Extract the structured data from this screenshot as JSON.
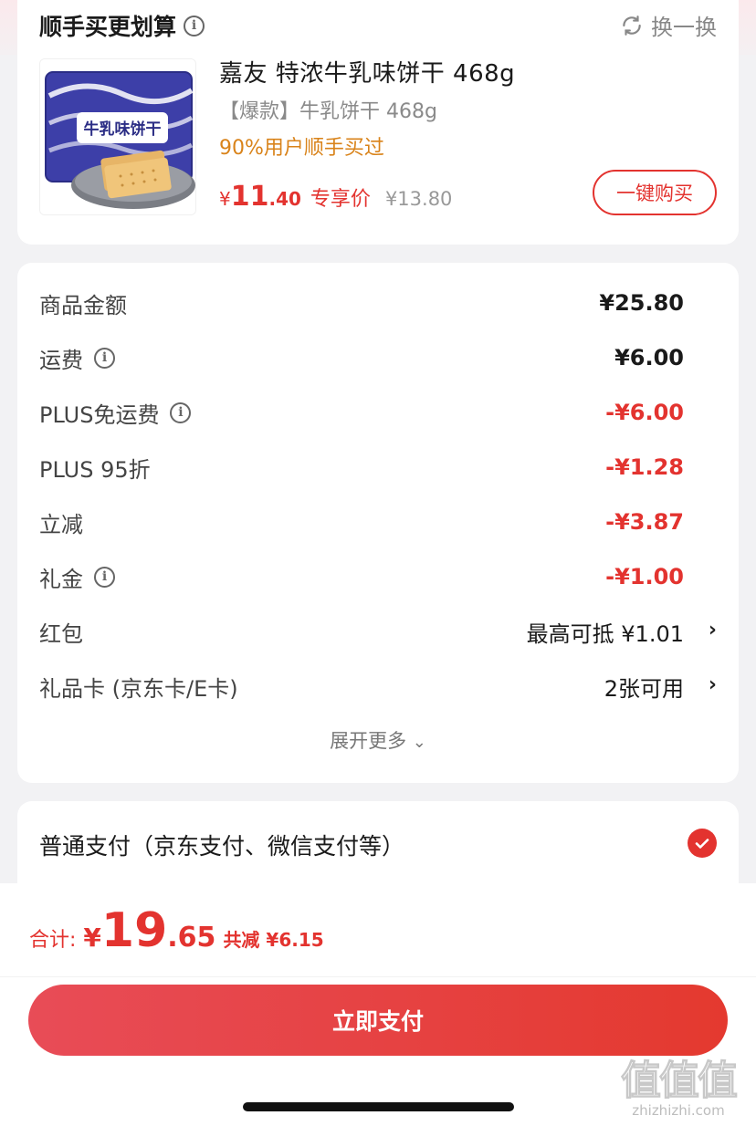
{
  "recommend": {
    "title": "顺手买更划算",
    "swap_label": "换一换",
    "product": {
      "name": "嘉友 特浓牛乳味饼干 468g",
      "subtitle": "【爆款】牛乳饼干 468g",
      "stat": "90%用户顺手买过",
      "price_currency": "¥",
      "price_int": "11",
      "price_dec": ".40",
      "price_tag": "专享价",
      "original_price": "¥13.80",
      "package_text": "牛乳味饼干",
      "buy_label": "一键购买"
    }
  },
  "summary": {
    "rows": [
      {
        "label": "商品金额",
        "value": "¥25.80",
        "info": false
      },
      {
        "label": "运费",
        "value": "¥6.00",
        "info": true
      },
      {
        "label": "PLUS免运费",
        "value": "-¥6.00",
        "info": true
      },
      {
        "label": "PLUS 95折",
        "value": "-¥1.28",
        "info": false
      },
      {
        "label": "立减",
        "value": "-¥3.87",
        "info": false
      },
      {
        "label": "礼金",
        "value": "-¥1.00",
        "info": true
      },
      {
        "label": "红包",
        "value": "最高可抵 ¥1.01",
        "info": false
      },
      {
        "label": "礼品卡 (京东卡/E卡)",
        "value": "2张可用",
        "info": false
      }
    ],
    "expand_label": "展开更多"
  },
  "payment": {
    "method_label": "普通支付（京东支付、微信支付等）"
  },
  "total": {
    "label": "合计:",
    "currency": "¥",
    "int": "19",
    "dec": ".65",
    "saved": "共减 ¥6.15"
  },
  "pay_button": "立即支付",
  "watermark": {
    "logo": "值值值",
    "url": "zhizhizhi.com"
  },
  "colors": {
    "accent": "#e3332f",
    "orange": "#d9831a",
    "background": "#f2f2f4"
  }
}
